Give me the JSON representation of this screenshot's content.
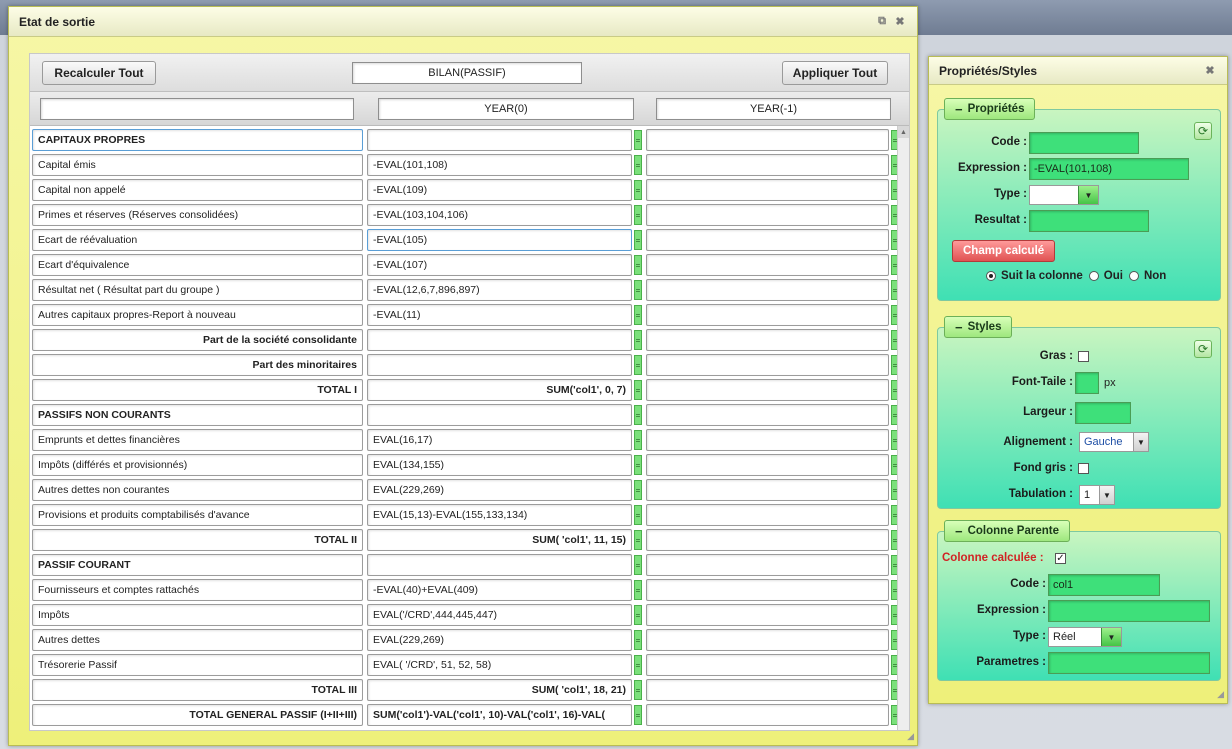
{
  "main_window": {
    "title": "Etat de sortie",
    "recalc_label": "Recalculer Tout",
    "report_title": "BILAN(PASSIF)",
    "apply_label": "Appliquer Tout",
    "label_header": "",
    "col0_header": "YEAR(0)",
    "col1_header": "YEAR(-1)"
  },
  "rows": [
    {
      "label": "CAPITAUX PROPRES",
      "expr": "",
      "style": "section"
    },
    {
      "label": "Capital émis",
      "expr": "-EVAL(101,108)",
      "style": "normal"
    },
    {
      "label": "Capital non appelé",
      "expr": "-EVAL(109)",
      "style": "normal"
    },
    {
      "label": "Primes et réserves (Réserves consolidées)",
      "expr": "-EVAL(103,104,106)",
      "style": "normal"
    },
    {
      "label": "Ecart de réévaluation",
      "expr": "-EVAL(105)",
      "style": "normal"
    },
    {
      "label": "Ecart d'équivalence",
      "expr": "-EVAL(107)",
      "style": "normal"
    },
    {
      "label": "Résultat net ( Résultat part du groupe )",
      "expr": "-EVAL(12,6,7,896,897)",
      "style": "normal"
    },
    {
      "label": "Autres capitaux propres-Report à nouveau",
      "expr": "-EVAL(11)",
      "style": "normal"
    },
    {
      "label": "Part de la société consolidante",
      "expr": "",
      "style": "subtotal"
    },
    {
      "label": "Part des minoritaires",
      "expr": "",
      "style": "subtotal"
    },
    {
      "label": "TOTAL I",
      "expr": "SUM('col1', 0, 7)",
      "style": "total"
    },
    {
      "label": "PASSIFS NON COURANTS",
      "expr": "",
      "style": "section"
    },
    {
      "label": "Emprunts et dettes financières",
      "expr": "EVAL(16,17)",
      "style": "normal"
    },
    {
      "label": "Impôts (différés et provisionnés)",
      "expr": "EVAL(134,155)",
      "style": "normal"
    },
    {
      "label": "Autres dettes non courantes",
      "expr": "EVAL(229,269)",
      "style": "normal"
    },
    {
      "label": "Provisions et produits comptabilisés d'avance",
      "expr": "EVAL(15,13)-EVAL(155,133,134)",
      "style": "normal"
    },
    {
      "label": "TOTAL II",
      "expr": "SUM( 'col1', 11, 15)",
      "style": "total"
    },
    {
      "label": "PASSIF COURANT",
      "expr": "",
      "style": "section"
    },
    {
      "label": "Fournisseurs et comptes rattachés",
      "expr": "-EVAL(40)+EVAL(409)",
      "style": "normal"
    },
    {
      "label": "Impôts",
      "expr": "EVAL('/CRD',444,445,447)",
      "style": "normal"
    },
    {
      "label": "Autres dettes",
      "expr": "EVAL(229,269)",
      "style": "normal"
    },
    {
      "label": "Trésorerie Passif",
      "expr": "EVAL( '/CRD', 51, 52, 58)",
      "style": "normal"
    },
    {
      "label": "TOTAL III",
      "expr": "SUM( 'col1', 18, 21)",
      "style": "total"
    },
    {
      "label": "TOTAL GENERAL PASSIF (I+II+III)",
      "expr": "SUM('col1')-VAL('col1', 10)-VAL('col1', 16)-VAL(",
      "style": "grand"
    }
  ],
  "side_panel": {
    "title": "Propriétés/Styles",
    "proprietes": {
      "legend": "Propriétés",
      "code_label": "Code :",
      "code_value": "",
      "expression_label": "Expression :",
      "expression_value": "-EVAL(101,108)",
      "type_label": "Type :",
      "type_value": "",
      "resultat_label": "Resultat :",
      "resultat_value": "",
      "champ_calcule_label": "Champ calculé",
      "radio_suit": "Suit la colonne",
      "radio_oui": "Oui",
      "radio_non": "Non"
    },
    "styles": {
      "legend": "Styles",
      "gras_label": "Gras :",
      "font_label": "Font-Taile :",
      "font_unit": "px",
      "largeur_label": "Largeur :",
      "align_label": "Alignement :",
      "align_value": "Gauche",
      "fond_label": "Fond gris :",
      "tab_label": "Tabulation :",
      "tab_value": "1"
    },
    "colonne": {
      "legend": "Colonne Parente",
      "calculee_label": "Colonne calculée :",
      "code_label": "Code :",
      "code_value": "col1",
      "expression_label": "Expression :",
      "expression_value": "",
      "type_label": "Type :",
      "type_value": "Réel",
      "parametres_label": "Parametres :",
      "parametres_value": ""
    }
  }
}
